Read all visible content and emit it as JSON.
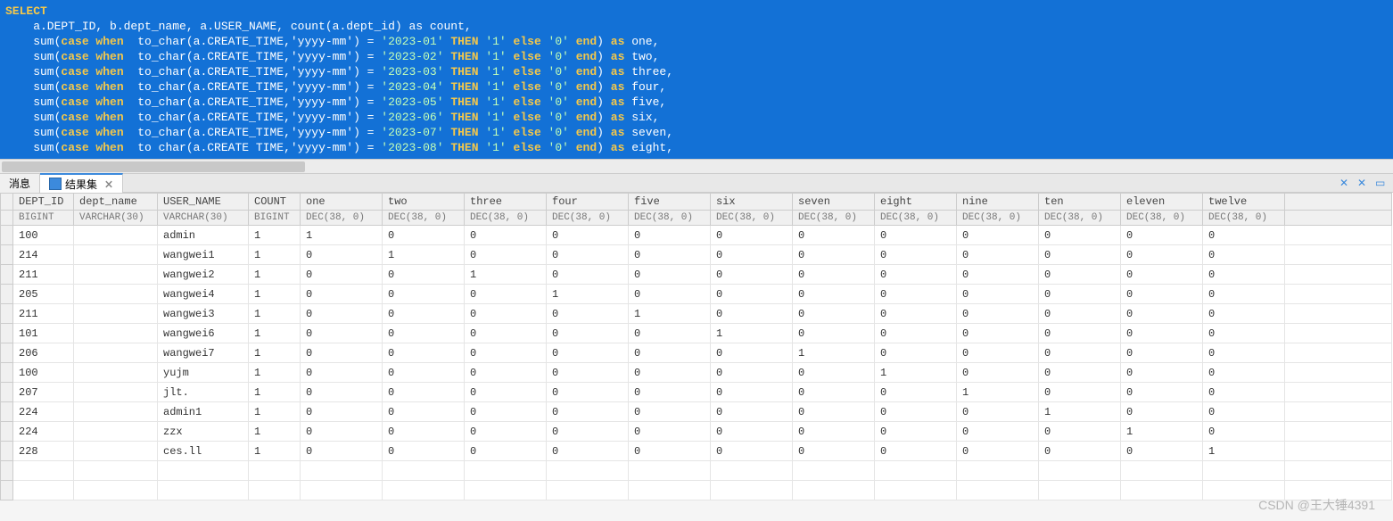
{
  "sql": {
    "keyword_select": "SELECT",
    "line1": "    a.DEPT_ID, b.dept_name, a.USER_NAME, count(a.dept_id) as count,",
    "lines": [
      {
        "pre": "    sum(",
        "kw1": "case when",
        "mid": "  to_char(a.CREATE_TIME,'yyyy-mm') = ",
        "str": "'2023-01'",
        "kw2": " THEN ",
        "s2": "'1'",
        "kw3": " else ",
        "s3": "'0'",
        "kw4": " end",
        "post": ") ",
        "kw5": "as",
        "alias": " one,"
      },
      {
        "pre": "    sum(",
        "kw1": "case when",
        "mid": "  to_char(a.CREATE_TIME,'yyyy-mm') = ",
        "str": "'2023-02'",
        "kw2": " THEN ",
        "s2": "'1'",
        "kw3": " else ",
        "s3": "'0'",
        "kw4": " end",
        "post": ") ",
        "kw5": "as",
        "alias": " two,"
      },
      {
        "pre": "    sum(",
        "kw1": "case when",
        "mid": "  to_char(a.CREATE_TIME,'yyyy-mm') = ",
        "str": "'2023-03'",
        "kw2": " THEN ",
        "s2": "'1'",
        "kw3": " else ",
        "s3": "'0'",
        "kw4": " end",
        "post": ") ",
        "kw5": "as",
        "alias": " three,"
      },
      {
        "pre": "    sum(",
        "kw1": "case when",
        "mid": "  to_char(a.CREATE_TIME,'yyyy-mm') = ",
        "str": "'2023-04'",
        "kw2": " THEN ",
        "s2": "'1'",
        "kw3": " else ",
        "s3": "'0'",
        "kw4": " end",
        "post": ") ",
        "kw5": "as",
        "alias": " four,"
      },
      {
        "pre": "    sum(",
        "kw1": "case when",
        "mid": "  to_char(a.CREATE_TIME,'yyyy-mm') = ",
        "str": "'2023-05'",
        "kw2": " THEN ",
        "s2": "'1'",
        "kw3": " else ",
        "s3": "'0'",
        "kw4": " end",
        "post": ") ",
        "kw5": "as",
        "alias": " five,"
      },
      {
        "pre": "    sum(",
        "kw1": "case when",
        "mid": "  to_char(a.CREATE_TIME,'yyyy-mm') = ",
        "str": "'2023-06'",
        "kw2": " THEN ",
        "s2": "'1'",
        "kw3": " else ",
        "s3": "'0'",
        "kw4": " end",
        "post": ") ",
        "kw5": "as",
        "alias": " six,"
      },
      {
        "pre": "    sum(",
        "kw1": "case when",
        "mid": "  to_char(a.CREATE_TIME,'yyyy-mm') = ",
        "str": "'2023-07'",
        "kw2": " THEN ",
        "s2": "'1'",
        "kw3": " else ",
        "s3": "'0'",
        "kw4": " end",
        "post": ") ",
        "kw5": "as",
        "alias": " seven,"
      },
      {
        "pre": "    sum(",
        "kw1": "case when",
        "mid": "  to char(a.CREATE TIME,'yyyy-mm') = ",
        "str": "'2023-08'",
        "kw2": " THEN ",
        "s2": "'1'",
        "kw3": " else ",
        "s3": "'0'",
        "kw4": " end",
        "post": ") ",
        "kw5": "as",
        "alias": " eight,"
      }
    ]
  },
  "tabs": {
    "items": [
      {
        "label": "消息",
        "active": false
      },
      {
        "label": "结果集",
        "active": true
      }
    ],
    "close_glyph": "⨯"
  },
  "columns": [
    {
      "name": "DEPT_ID",
      "type": "BIGINT",
      "cls": "col-dept"
    },
    {
      "name": "dept_name",
      "type": "VARCHAR(30)",
      "cls": "col-dname"
    },
    {
      "name": "USER_NAME",
      "type": "VARCHAR(30)",
      "cls": "col-uname"
    },
    {
      "name": "COUNT",
      "type": "BIGINT",
      "cls": "col-count"
    },
    {
      "name": "one",
      "type": "DEC(38, 0)",
      "cls": "col-month"
    },
    {
      "name": "two",
      "type": "DEC(38, 0)",
      "cls": "col-month"
    },
    {
      "name": "three",
      "type": "DEC(38, 0)",
      "cls": "col-month"
    },
    {
      "name": "four",
      "type": "DEC(38, 0)",
      "cls": "col-month"
    },
    {
      "name": "five",
      "type": "DEC(38, 0)",
      "cls": "col-month"
    },
    {
      "name": "six",
      "type": "DEC(38, 0)",
      "cls": "col-month"
    },
    {
      "name": "seven",
      "type": "DEC(38, 0)",
      "cls": "col-month"
    },
    {
      "name": "eight",
      "type": "DEC(38, 0)",
      "cls": "col-month"
    },
    {
      "name": "nine",
      "type": "DEC(38, 0)",
      "cls": "col-month"
    },
    {
      "name": "ten",
      "type": "DEC(38, 0)",
      "cls": "col-month"
    },
    {
      "name": "eleven",
      "type": "DEC(38, 0)",
      "cls": "col-month"
    },
    {
      "name": "twelve",
      "type": "DEC(38, 0)",
      "cls": "col-month"
    }
  ],
  "rows": [
    {
      "c": [
        "100",
        "",
        "admin",
        "1",
        "1",
        "0",
        "0",
        "0",
        "0",
        "0",
        "0",
        "0",
        "0",
        "0",
        "0",
        "0"
      ]
    },
    {
      "c": [
        "214",
        "",
        "wangwei1",
        "1",
        "0",
        "1",
        "0",
        "0",
        "0",
        "0",
        "0",
        "0",
        "0",
        "0",
        "0",
        "0"
      ]
    },
    {
      "c": [
        "211",
        "",
        "wangwei2",
        "1",
        "0",
        "0",
        "1",
        "0",
        "0",
        "0",
        "0",
        "0",
        "0",
        "0",
        "0",
        "0"
      ]
    },
    {
      "c": [
        "205",
        "",
        "wangwei4",
        "1",
        "0",
        "0",
        "0",
        "1",
        "0",
        "0",
        "0",
        "0",
        "0",
        "0",
        "0",
        "0"
      ]
    },
    {
      "c": [
        "211",
        "",
        "wangwei3",
        "1",
        "0",
        "0",
        "0",
        "0",
        "1",
        "0",
        "0",
        "0",
        "0",
        "0",
        "0",
        "0"
      ]
    },
    {
      "c": [
        "101",
        "",
        "wangwei6",
        "1",
        "0",
        "0",
        "0",
        "0",
        "0",
        "1",
        "0",
        "0",
        "0",
        "0",
        "0",
        "0"
      ]
    },
    {
      "c": [
        "206",
        "",
        "wangwei7",
        "1",
        "0",
        "0",
        "0",
        "0",
        "0",
        "0",
        "1",
        "0",
        "0",
        "0",
        "0",
        "0"
      ]
    },
    {
      "c": [
        "100",
        "",
        "yujm",
        "1",
        "0",
        "0",
        "0",
        "0",
        "0",
        "0",
        "0",
        "1",
        "0",
        "0",
        "0",
        "0"
      ]
    },
    {
      "c": [
        "207",
        "",
        "jlt.",
        "1",
        "0",
        "0",
        "0",
        "0",
        "0",
        "0",
        "0",
        "0",
        "1",
        "0",
        "0",
        "0"
      ]
    },
    {
      "c": [
        "224",
        "",
        "admin1",
        "1",
        "0",
        "0",
        "0",
        "0",
        "0",
        "0",
        "0",
        "0",
        "0",
        "1",
        "0",
        "0"
      ]
    },
    {
      "c": [
        "224",
        "",
        "zzx",
        "1",
        "0",
        "0",
        "0",
        "0",
        "0",
        "0",
        "0",
        "0",
        "0",
        "0",
        "1",
        "0"
      ]
    },
    {
      "c": [
        "228",
        "",
        "ces.ll",
        "1",
        "0",
        "0",
        "0",
        "0",
        "0",
        "0",
        "0",
        "0",
        "0",
        "0",
        "0",
        "1"
      ]
    }
  ],
  "watermark": "CSDN @王大锤4391"
}
